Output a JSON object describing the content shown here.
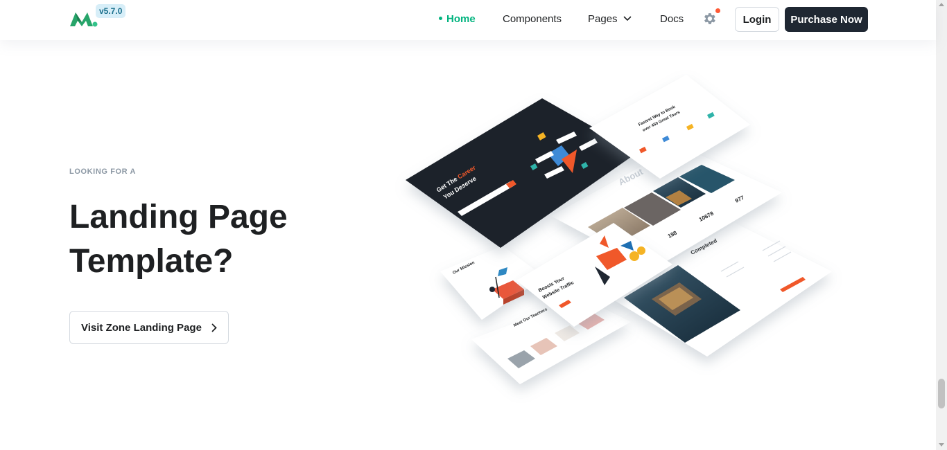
{
  "header": {
    "version": "v5.7.0",
    "nav": {
      "home": "Home",
      "components": "Components",
      "pages": "Pages",
      "docs": "Docs"
    },
    "login": "Login",
    "purchase": "Purchase Now"
  },
  "hero": {
    "eyebrow": "LOOKING FOR A",
    "title_line1": "Landing Page",
    "title_line2": "Template?",
    "cta": "Visit Zone Landing Page"
  },
  "mockup": {
    "career_title_1": "Get The",
    "career_title_highlight": "Career",
    "career_title_2": "You Deserve",
    "tours_title_1": "Fastest Way to Book",
    "tours_title_2": "over 450 Great Tours",
    "about": "About",
    "stat_1": "198",
    "stat_2": "10678",
    "stat_3": "977",
    "mission": "Our Mission",
    "boost_1": "Boosts Your",
    "boost_2": "Website Traffic",
    "completed": "Completed",
    "teachers": "Meet Our Teachers"
  },
  "colors": {
    "accent_green": "#00b37e",
    "dark_button": "#1f2732",
    "notification_dot": "#ff5a36",
    "mock_orange": "#f0582a"
  },
  "icons": [
    "logo-icon",
    "chevron-down-icon",
    "gear-icon",
    "chevron-right-icon"
  ]
}
